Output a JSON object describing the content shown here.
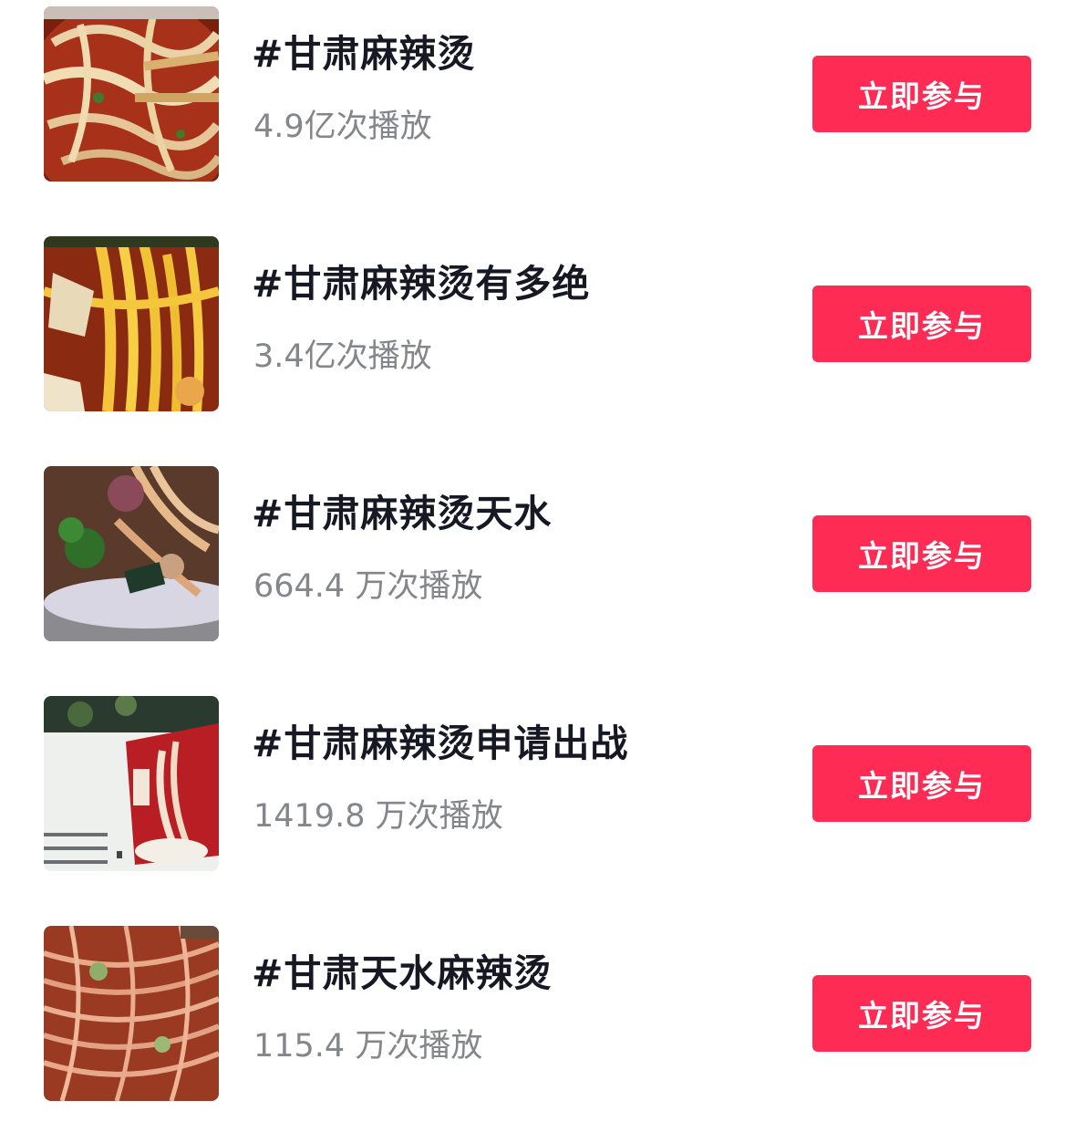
{
  "colors": {
    "button_bg": "#fe2c55",
    "title_text": "#161823",
    "plays_text": "#84868b"
  },
  "topics": [
    {
      "title": "#甘肃麻辣烫",
      "plays": "4.9亿次播放",
      "button_label": "立即参与",
      "thumbnail_icon": "food-photo-noodle-bowl"
    },
    {
      "title": "#甘肃麻辣烫有多绝",
      "plays": "3.4亿次播放",
      "button_label": "立即参与",
      "thumbnail_icon": "food-photo-yellow-noodles"
    },
    {
      "title": "#甘肃麻辣烫天水",
      "plays": "664.4 万次播放",
      "button_label": "立即参与",
      "thumbnail_icon": "food-photo-noodles-vegetables"
    },
    {
      "title": "#甘肃麻辣烫申请出战",
      "plays": "1419.8 万次播放",
      "button_label": "立即参与",
      "thumbnail_icon": "restaurant-wall-photo"
    },
    {
      "title": "#甘肃天水麻辣烫",
      "plays": "115.4 万次播放",
      "button_label": "立即参与",
      "thumbnail_icon": "food-photo-chili-noodles"
    }
  ]
}
